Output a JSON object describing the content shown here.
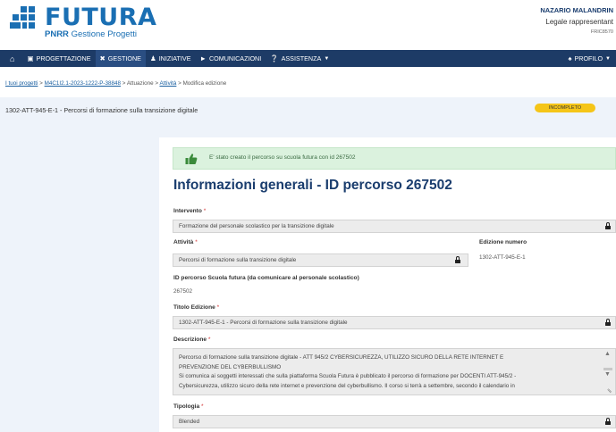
{
  "header": {
    "logo_title": "FUTURA",
    "logo_sub_bold": "PNRR",
    "logo_sub": "Gestione Progetti",
    "user_name": "NAZARIO MALANDRIN",
    "user_role": "Legale rappresentant",
    "user_code": "FRIC8570"
  },
  "nav": {
    "items": [
      {
        "label": "PROGETTAZIONE",
        "icon": "building-icon"
      },
      {
        "label": "GESTIONE",
        "icon": "tools-icon",
        "active": true
      },
      {
        "label": "INIZIATIVE",
        "icon": "people-icon"
      },
      {
        "label": "COMUNICAZIONI",
        "icon": "megaphone-icon"
      },
      {
        "label": "ASSISTENZA",
        "icon": "help-icon"
      }
    ],
    "profile_label": "PROFILO"
  },
  "breadcrumb": {
    "items": [
      "I tuoi progetti",
      "M4C1I2.1-2023-1222-P-38848",
      "Attuazione",
      "Attività",
      "Modifica edizione"
    ],
    "separator": ">"
  },
  "titlebar": {
    "title": "1302-ATT-945-E-1 - Percorsi di formazione sulla transizione digitale",
    "status": "INCOMPLETO",
    "status_color": "#f5c518"
  },
  "alert": {
    "message": "E' stato creato il percorso su scuola futura con id 267502",
    "icon": "thumbs-up-icon",
    "color": "#dbf2de"
  },
  "form": {
    "section_title": "Informazioni generali - ID percorso 267502",
    "intervento_label": "Intervento",
    "intervento_value": "Formazione del personale scolastico per la transizione digitale",
    "attivita_label": "Attività",
    "attivita_value": "Percorsi di formazione sulla transizione digitale",
    "edizione_label": "Edizione numero",
    "edizione_value": "1302-ATT-945-E-1",
    "id_label": "ID percorso Scuola futura (da comunicare al personale scolastico)",
    "id_value": "267502",
    "titolo_label": "Titolo Edizione",
    "titolo_value": "1302-ATT-945-E-1 - Percorsi di formazione sulla transizione digitale",
    "descrizione_label": "Descrizione",
    "descrizione_lines": [
      "Percorso di formazione sulla transizione digitale - ATT 945/2 CYBERSICUREZZA, UTILIZZO SICURO DELLA RETE INTERNET E",
      "PREVENZIONE DEL CYBERBULLISMO",
      "Si comunica ai soggetti interessati che sulla piattaforma Scuola Futura è pubblicato il percorso di formazione per DOCENTI ATT-945/2 -",
      "Cybersicurezza, utilizzo sicuro della rete internet e prevenzione del cyberbullismo. Il corso si terrà a settembre, secondo il calendario in"
    ],
    "tipologia_label": "Tipologia",
    "tipologia_value": "Blended",
    "required_mark": "*"
  }
}
